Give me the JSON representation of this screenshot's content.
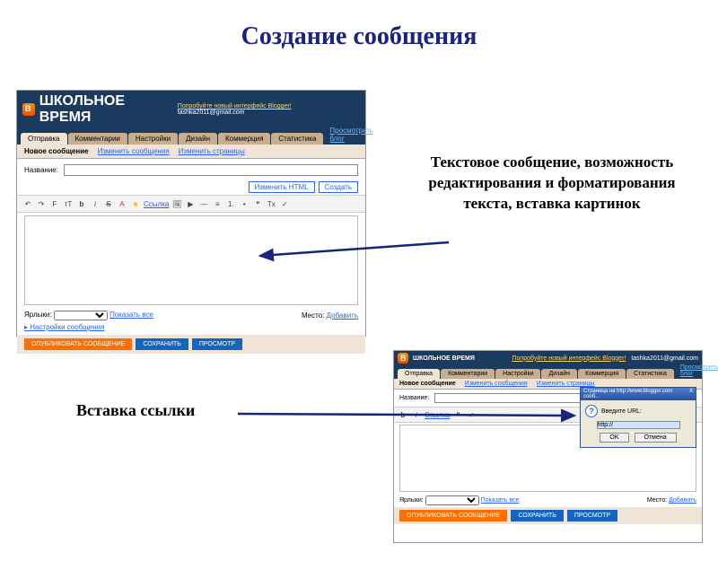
{
  "slide": {
    "title": "Создание сообщения"
  },
  "annotations": {
    "text_editing": "Текстовое сообщение, возможность редактирования и форматирования текста, вставка картинок",
    "insert_link": "Вставка ссылки"
  },
  "blogger": {
    "brand": "ШКОЛЬНОЕ ВРЕМЯ",
    "try_new": "Попробуйте новый интерфейс Blogger!",
    "email": "tashka2011@gmail.com",
    "tabs": [
      "Отправка",
      "Комментарии",
      "Настройки",
      "Дизайн",
      "Коммерция",
      "Статистика"
    ],
    "view_blog": "Просмотреть блог",
    "subtabs": {
      "new": "Новое сообщение",
      "edit": "Изменить сообщения",
      "pages": "Изменить страницы"
    },
    "title_label": "Название:",
    "mode": {
      "html": "Изменить HTML",
      "compose": "Создать"
    },
    "toolbar": {
      "undo": "↶",
      "redo": "↷",
      "font": "F",
      "size": "тТ",
      "bold": "b",
      "italic": "i",
      "strike": "S",
      "color": "A",
      "bg": "■",
      "link": "Ссылка",
      "image": "🖼",
      "video": "▶",
      "more": "—",
      "align": "≡",
      "list_num": "1.",
      "list_bul": "•",
      "quote": "❝",
      "clear": "Tx",
      "spell": "✓"
    },
    "labels_label": "Ярлыки:",
    "show_all": "Показать все",
    "place_label": "Место:",
    "place_add": "Добавить",
    "post_settings": "Настройки сообщения",
    "actions": {
      "publish": "ОПУБЛИКОВАТЬ СООБЩЕНИЕ",
      "save": "СОХРАНИТЬ",
      "preview": "ПРОСМОТР"
    }
  },
  "dialog": {
    "title": "Страница на http://www.blogger.com сооб...",
    "prompt": "Введите URL:",
    "default_value": "http://",
    "ok": "OK",
    "cancel": "Отмена",
    "close": "X"
  }
}
